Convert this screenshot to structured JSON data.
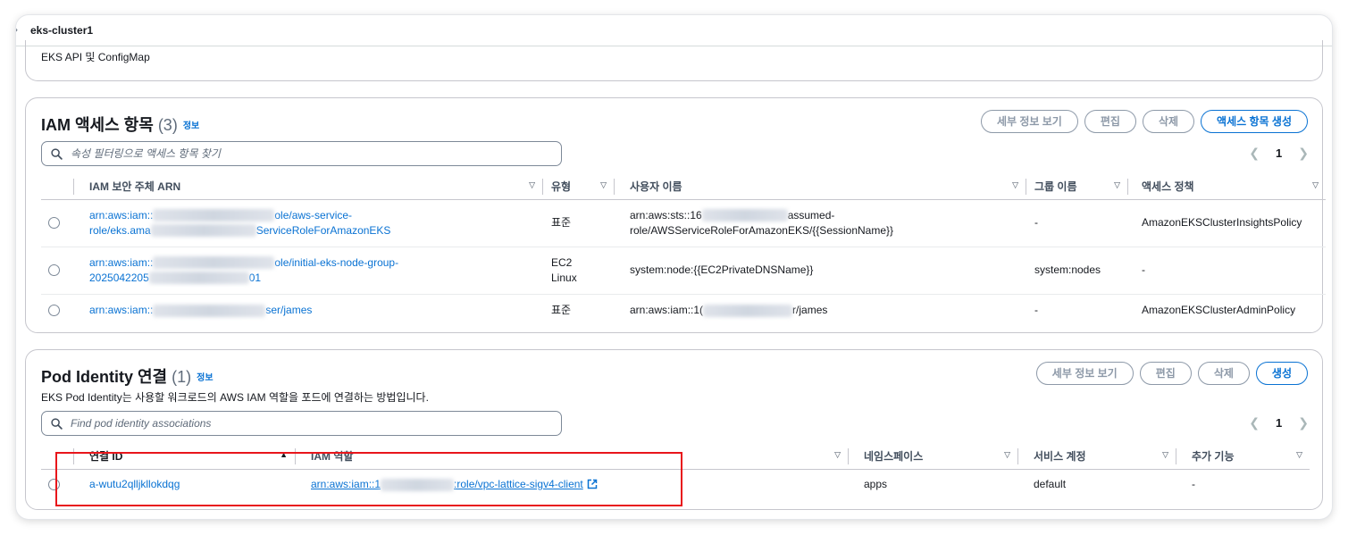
{
  "header": {
    "cluster_name": "eks-cluster1"
  },
  "top_section": {
    "text": "EKS API 및 ConfigMap"
  },
  "iam_access": {
    "title": "IAM 액세스 항목",
    "count": "(3)",
    "info": "정보",
    "buttons": {
      "details": "세부 정보 보기",
      "edit": "편집",
      "delete": "삭제",
      "create": "액세스 항목 생성"
    },
    "search_placeholder": "속성 필터링으로 액세스 항목 찾기",
    "page": "1",
    "columns": [
      "IAM 보안 주체 ARN",
      "유형",
      "사용자 이름",
      "그룹 이름",
      "액세스 정책"
    ],
    "rows": [
      {
        "arn_a": "arn:aws:iam::",
        "arn_b": "ole/aws-service-",
        "arn_c": "role/eks.ama",
        "arn_d": "ServiceRoleForAmazonEKS",
        "type": "표준",
        "user_a": "arn:aws:sts::16",
        "user_b": "assumed-",
        "user_c": "role/AWSServiceRoleForAmazonEKS/{{SessionName}}",
        "group": "-",
        "policy": "AmazonEKSClusterInsightsPolicy"
      },
      {
        "arn_a": "arn:aws:iam::",
        "arn_b": "ole/initial-eks-node-group-",
        "arn_c": "2025042205",
        "arn_d": "01",
        "type_a": "EC2",
        "type_b": "Linux",
        "user": "system:node:{{EC2PrivateDNSName}}",
        "group": "system:nodes",
        "policy": "-"
      },
      {
        "arn_a": "arn:aws:iam::",
        "arn_b": "ser/james",
        "type": "표준",
        "user_a": "arn:aws:iam::1(",
        "user_b": "r/james",
        "group": "-",
        "policy": "AmazonEKSClusterAdminPolicy"
      }
    ]
  },
  "pod_identity": {
    "title": "Pod Identity 연결",
    "count": "(1)",
    "info": "정보",
    "description": "EKS Pod Identity는 사용할 워크로드의 AWS IAM 역할을 포드에 연결하는 방법입니다.",
    "buttons": {
      "details": "세부 정보 보기",
      "edit": "편집",
      "delete": "삭제",
      "create": "생성"
    },
    "search_placeholder": "Find pod identity associations",
    "page": "1",
    "columns": [
      "연결 ID",
      "IAM 역할",
      "네임스페이스",
      "서비스 계정",
      "추가 기능"
    ],
    "rows": [
      {
        "id": "a-wutu2qlljkllokdqg",
        "role_a": "arn:aws:iam::1",
        "role_b": ":role/vpc-lattice-sigv4-client",
        "namespace": "apps",
        "service_account": "default",
        "addon": "-"
      }
    ]
  },
  "colors": {
    "link": "#0972d3",
    "highlight": "#e8161b"
  }
}
